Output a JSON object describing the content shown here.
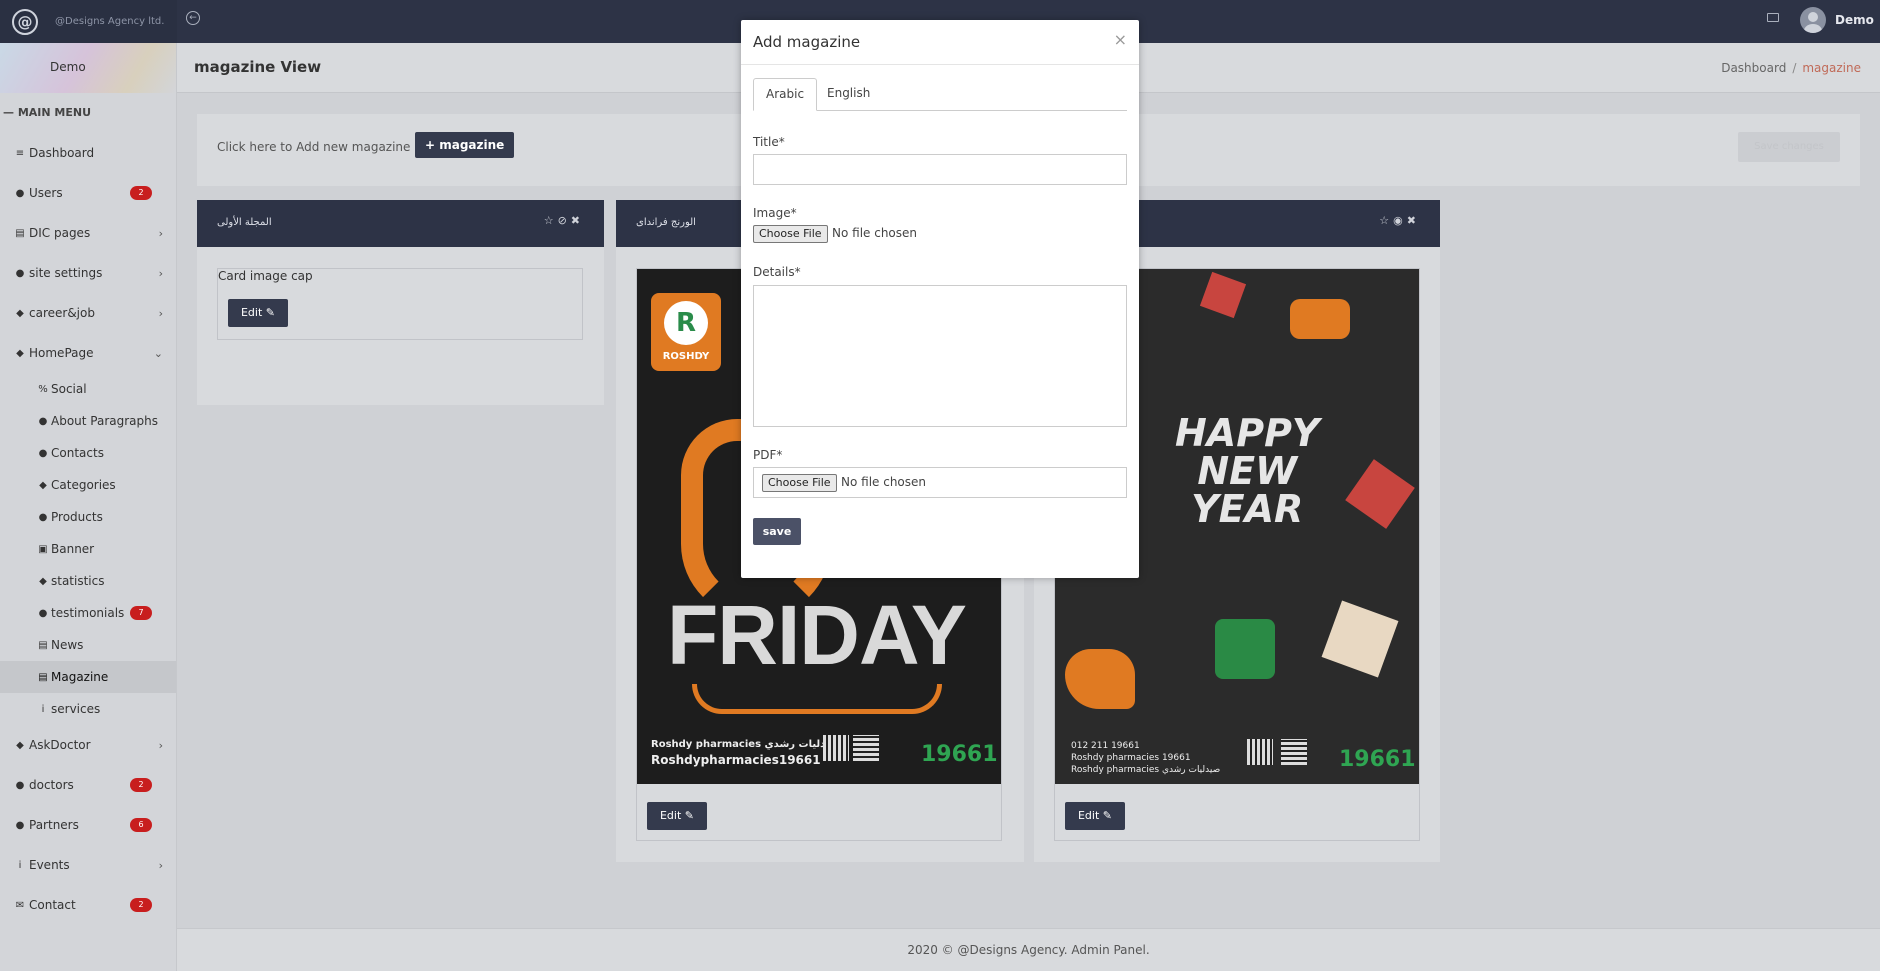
{
  "topbar": {
    "brand": "@Designs Agency ltd.",
    "user_name": "Demo"
  },
  "sidebar": {
    "profile_name": "Demo",
    "menu_title": "MAIN MENU",
    "items": [
      {
        "label": "Dashboard",
        "icon": "dashboard-icon"
      },
      {
        "label": "Users",
        "icon": "users-icon",
        "badge": "2"
      },
      {
        "label": "DIC pages",
        "icon": "table-icon"
      },
      {
        "label": "site settings",
        "icon": "circle-icon"
      },
      {
        "label": "career&job",
        "icon": "tag-icon"
      },
      {
        "label": "HomePage",
        "icon": "tag-icon"
      }
    ],
    "sub_items": [
      {
        "label": "Social",
        "icon": "link-icon"
      },
      {
        "label": "About Paragraphs",
        "icon": "circle-icon"
      },
      {
        "label": "Contacts",
        "icon": "circle-icon"
      },
      {
        "label": "Categories",
        "icon": "tag-icon"
      },
      {
        "label": "Products",
        "icon": "product-icon"
      },
      {
        "label": "Banner",
        "icon": "image-icon"
      },
      {
        "label": "statistics",
        "icon": "tag-icon"
      },
      {
        "label": "testimonials",
        "icon": "circle-icon",
        "badge": "7"
      },
      {
        "label": "News",
        "icon": "news-icon"
      },
      {
        "label": "Magazine",
        "icon": "news-icon"
      },
      {
        "label": "services",
        "icon": "info-icon"
      }
    ],
    "items_after": [
      {
        "label": "AskDoctor",
        "icon": "tag-icon"
      },
      {
        "label": "doctors",
        "icon": "circle-icon",
        "badge": "2"
      },
      {
        "label": "Partners",
        "icon": "users-icon",
        "badge": "6"
      },
      {
        "label": "Events",
        "icon": "info-icon"
      },
      {
        "label": "Contact",
        "icon": "mail-icon",
        "badge": "2"
      }
    ]
  },
  "page": {
    "title": "magazine View",
    "breadcrumb_home": "Dashboard",
    "breadcrumb_sep": "/",
    "breadcrumb_current": "magazine",
    "add_text": "Click here to Add new magazine",
    "add_button": "+ magazine",
    "bulk_button": "Save changes"
  },
  "cards": [
    {
      "title": "المجلة الأولى",
      "img_alt": "Card image cap",
      "edit": "Edit"
    },
    {
      "title": "الورنج فرانداى",
      "edit": "Edit",
      "poster_text": "FRIDAY",
      "poster_brand": "ROSHDY",
      "poster_line1": "Roshdy pharmacies صيدليات رشدي",
      "poster_line2": "Roshdypharmacies19661",
      "poster_hotline": "19661"
    },
    {
      "title": "",
      "edit": "Edit",
      "poster_text1": "HAPPY",
      "poster_text2": "NEW",
      "poster_text3": "YEAR",
      "poster_line1": "012 211 19661",
      "poster_line2": "Roshdy pharmacies 19661",
      "poster_line3": "Roshdy pharmacies صيدليات رشدي",
      "poster_hotline": "19661"
    }
  ],
  "modal": {
    "title": "Add magazine",
    "close": "×",
    "tabs": [
      "Arabic",
      "English"
    ],
    "title_label": "Title*",
    "image_label": "Image*",
    "details_label": "Details*",
    "pdf_label": "PDF*",
    "file_button": "Choose File",
    "file_none": "No file chosen",
    "save": "save"
  },
  "footer": {
    "text": "2020 © @Designs Agency. Admin Panel."
  }
}
